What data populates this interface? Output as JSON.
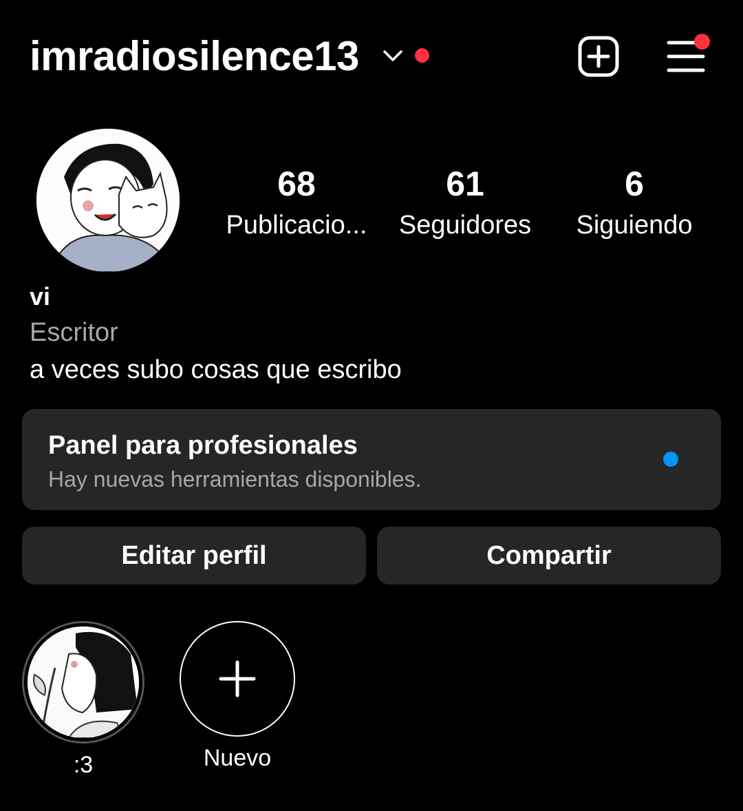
{
  "header": {
    "username": "imradiosilence13",
    "icons": [
      "chevron-down-icon",
      "notification-dot",
      "add-content-icon",
      "menu-icon"
    ],
    "accent_red": "#ff3040"
  },
  "profile": {
    "stats": [
      {
        "value": "68",
        "label": "Publicacio..."
      },
      {
        "value": "61",
        "label": "Seguidores"
      },
      {
        "value": "6",
        "label": "Siguiendo"
      }
    ],
    "name": "vi",
    "category": "Escritor",
    "bio": "a veces subo cosas que escribo"
  },
  "panel": {
    "title": "Panel para profesionales",
    "subtitle": "Hay nuevas herramientas disponibles.",
    "dot_color": "#0095f6"
  },
  "actions": {
    "edit": "Editar perfil",
    "share": "Compartir"
  },
  "highlights": [
    {
      "label": ":3"
    },
    {
      "label": "Nuevo"
    }
  ]
}
